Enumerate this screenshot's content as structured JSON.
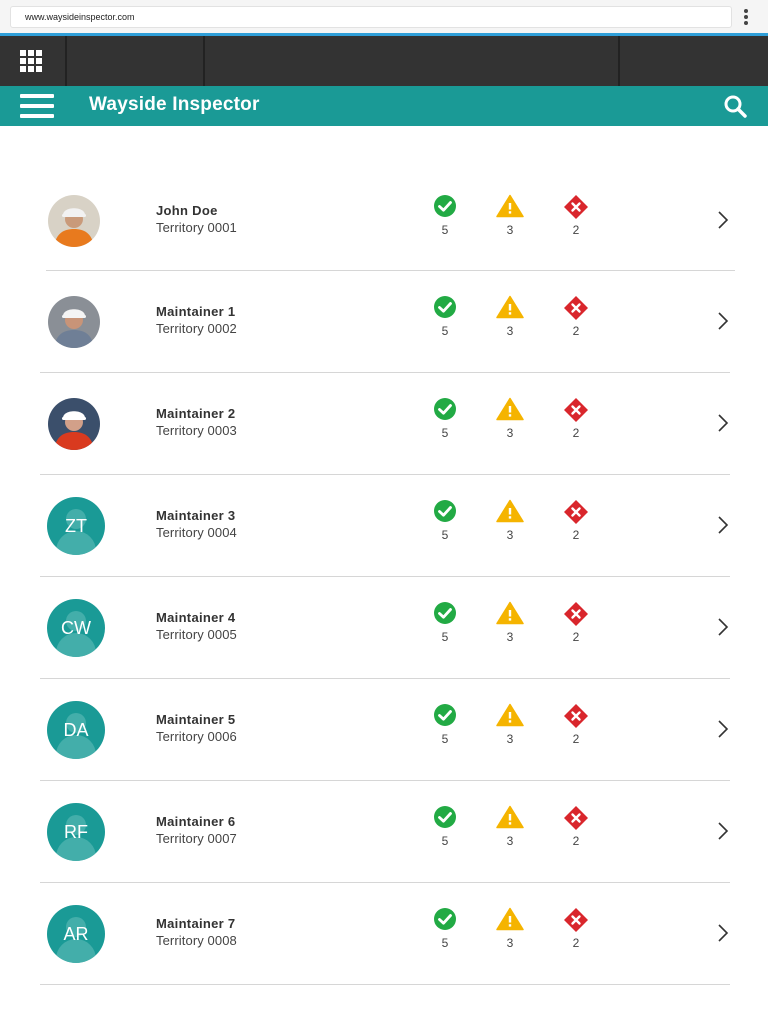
{
  "browser": {
    "url": "www.waysideinspector.com"
  },
  "header": {
    "title": "Wayside Inspector"
  },
  "colors": {
    "brand": "#1a9a96",
    "topbar": "#333333",
    "ok": "#22aa44",
    "warn": "#f5b400",
    "error": "#d9262c"
  },
  "list": {
    "items": [
      {
        "name": "John Doe",
        "territory": "Territory 0001",
        "avatar": "photo",
        "initials": "",
        "ok": "5",
        "warn": "3",
        "error": "2"
      },
      {
        "name": "Maintainer 1",
        "territory": "Territory 0002",
        "avatar": "photo",
        "initials": "",
        "ok": "5",
        "warn": "3",
        "error": "2"
      },
      {
        "name": "Maintainer 2",
        "territory": "Territory 0003",
        "avatar": "photo",
        "initials": "",
        "ok": "5",
        "warn": "3",
        "error": "2"
      },
      {
        "name": "Maintainer 3",
        "territory": "Territory 0004",
        "avatar": "initials",
        "initials": "ZT",
        "ok": "5",
        "warn": "3",
        "error": "2"
      },
      {
        "name": "Maintainer 4",
        "territory": "Territory 0005",
        "avatar": "initials",
        "initials": "CW",
        "ok": "5",
        "warn": "3",
        "error": "2"
      },
      {
        "name": "Maintainer 5",
        "territory": "Territory 0006",
        "avatar": "initials",
        "initials": "DA",
        "ok": "5",
        "warn": "3",
        "error": "2"
      },
      {
        "name": "Maintainer 6",
        "territory": "Territory 0007",
        "avatar": "initials",
        "initials": "RF",
        "ok": "5",
        "warn": "3",
        "error": "2"
      },
      {
        "name": "Maintainer 7",
        "territory": "Territory 0008",
        "avatar": "initials",
        "initials": "AR",
        "ok": "5",
        "warn": "3",
        "error": "2"
      }
    ]
  }
}
